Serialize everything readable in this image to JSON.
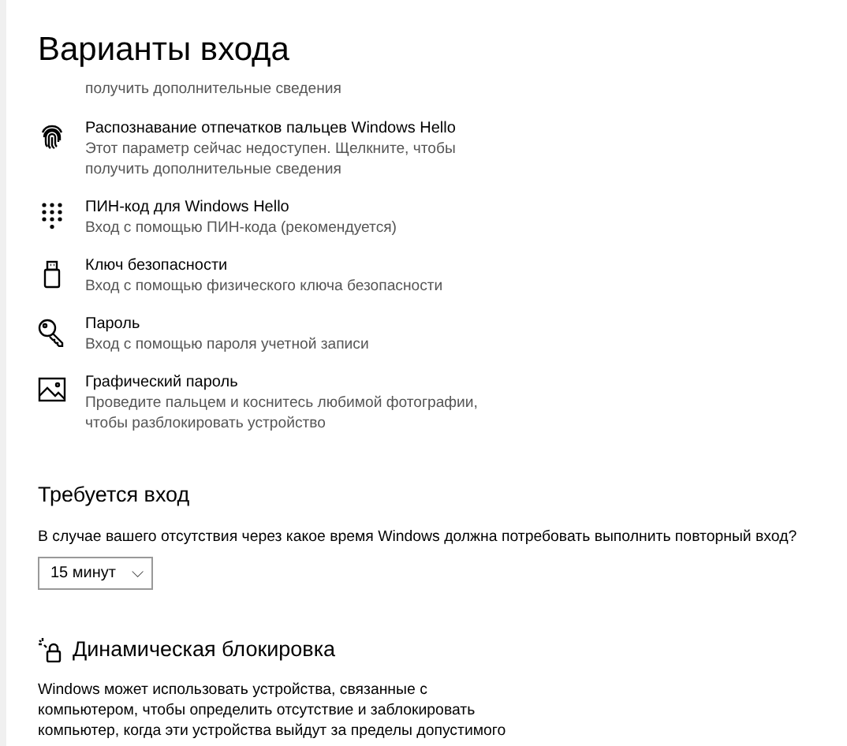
{
  "title": "Варианты входа",
  "cut_description": "получить дополнительные сведения",
  "options": [
    {
      "kind": "fingerprint",
      "title": "Распознавание отпечатков пальцев Windows Hello",
      "description": [
        "Этот параметр сейчас недоступен. Щелкните, чтобы",
        "получить дополнительные сведения"
      ]
    },
    {
      "kind": "pin",
      "title": "ПИН-код для Windows Hello",
      "description": [
        "Вход с помощью ПИН-кода (рекомендуется)"
      ]
    },
    {
      "kind": "usb",
      "title": "Ключ безопасности",
      "description": [
        "Вход с помощью физического ключа безопасности"
      ]
    },
    {
      "kind": "key",
      "title": "Пароль",
      "description": [
        "Вход с помощью пароля учетной записи"
      ]
    },
    {
      "kind": "image",
      "title": "Графический пароль",
      "description": [
        "Проведите пальцем и коснитесь любимой фотографии,",
        "чтобы разблокировать устройство"
      ]
    }
  ],
  "require_signin": {
    "heading": "Требуется вход",
    "question": "В случае вашего отсутствия через какое время Windows должна потребовать выполнить повторный вход?",
    "dropdown": {
      "value": "15 минут",
      "caret": "⌵"
    }
  },
  "dynamic_lock": {
    "heading": "Динамическая блокировка",
    "text": [
      "Windows может использовать устройства, связанные с",
      "компьютером, чтобы определить отсутствие и заблокировать",
      "компьютер, когда эти устройства выйдут за пределы допустимого"
    ]
  }
}
